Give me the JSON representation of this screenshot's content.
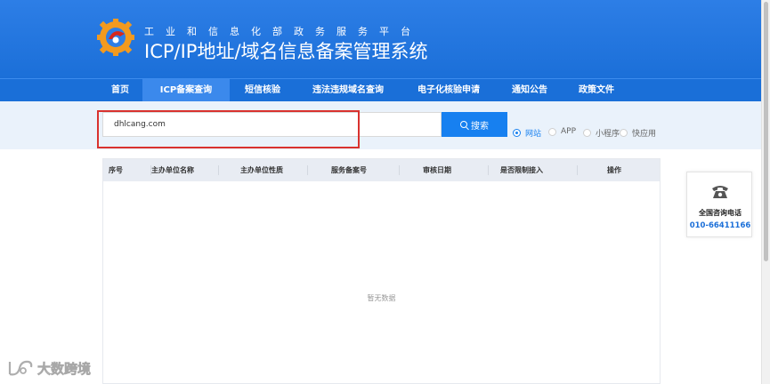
{
  "header": {
    "subtitle": "工业和信息化部政务服务平台",
    "title": "ICP/IP地址/域名信息备案管理系统",
    "logo_icon": "miit-gear-logo-icon"
  },
  "nav": {
    "items": [
      {
        "label": "首页"
      },
      {
        "label": "ICP备案查询"
      },
      {
        "label": "短信核验"
      },
      {
        "label": "违法违规域名查询"
      },
      {
        "label": "电子化核验申请"
      },
      {
        "label": "通知公告"
      },
      {
        "label": "政策文件"
      }
    ],
    "active": "ICP备案查询"
  },
  "search": {
    "value": "dhlcang.com",
    "button_label": "搜索",
    "types": [
      {
        "label": "网站",
        "checked": true
      },
      {
        "label": "APP",
        "checked": false
      },
      {
        "label": "小程序",
        "checked": false
      },
      {
        "label": "快应用",
        "checked": false
      }
    ]
  },
  "table": {
    "columns": [
      "序号",
      "主办单位名称",
      "主办单位性质",
      "服务备案号",
      "审核日期",
      "是否限制接入",
      "操作"
    ],
    "empty_text": "暂无数据"
  },
  "contact": {
    "label": "全国咨询电话",
    "phone": "010-66411166",
    "icon": "telephone-icon"
  },
  "watermark": {
    "text": "大数跨境"
  },
  "colors": {
    "brand_blue": "#1b6fd8",
    "button_blue": "#1780f0",
    "highlight_red": "#d9322e"
  }
}
